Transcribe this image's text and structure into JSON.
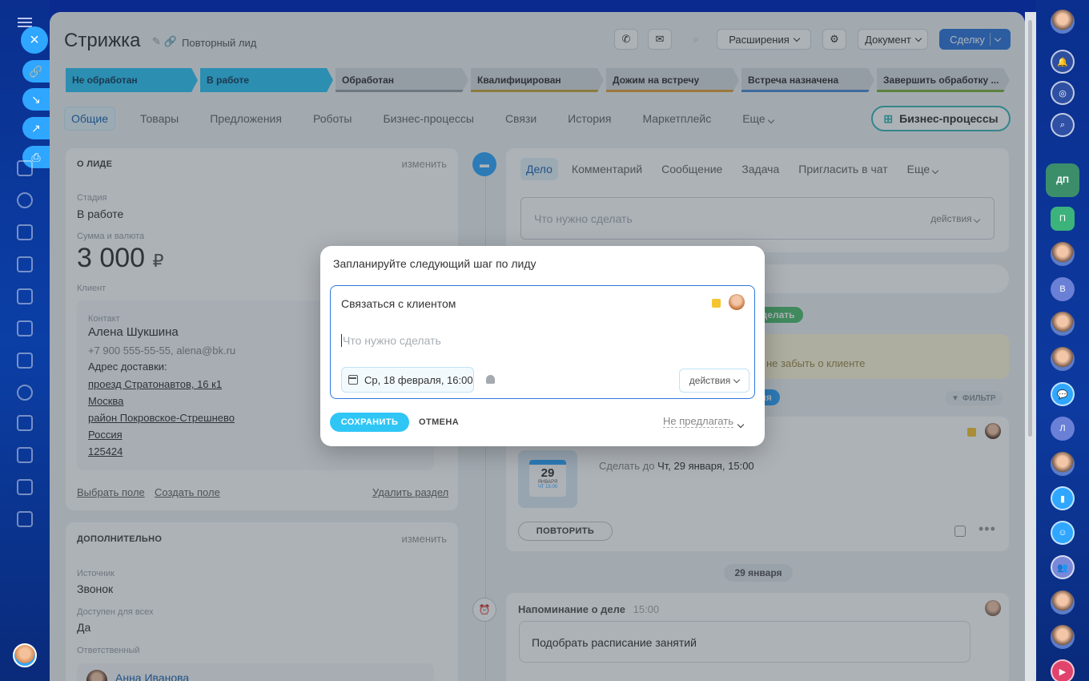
{
  "header": {
    "title": "Стрижка",
    "subtitle": "Повторный лид",
    "extensions_label": "Расширения",
    "document_label": "Документ",
    "primary_label": "Сделку"
  },
  "stages": [
    "Не обработан",
    "В работе",
    "Обработан",
    "Квалифицирован",
    "Дожим на встречу",
    "Встреча назначена",
    "Завершить обработку ..."
  ],
  "tabs": [
    "Общие",
    "Товары",
    "Предложения",
    "Роботы",
    "Бизнес-процессы",
    "Связи",
    "История",
    "Маркетплейс",
    "Еще"
  ],
  "bp_button": "Бизнес-процессы",
  "about": {
    "heading": "О ЛИДЕ",
    "edit": "изменить",
    "stage_label": "Стадия",
    "stage_value": "В работе",
    "sum_label": "Сумма и валюта",
    "sum_value": "3 000",
    "currency": "₽",
    "client_label": "Клиент",
    "contact_label": "Контакт",
    "contact_name": "Алена Шукшина",
    "contact_info": "+7 900 555-55-55, alena@bk.ru",
    "address_label": "Адрес доставки:",
    "address_lines": [
      "проезд Стратонавтов, 16 к1",
      "Москва",
      "район Покровское-Стрешнево",
      "Россия",
      "125424"
    ],
    "choose_field": "Выбрать поле",
    "create_field": "Создать поле",
    "delete_section": "Удалить раздел"
  },
  "extra": {
    "heading": "ДОПОЛНИТЕЛЬНО",
    "edit": "изменить",
    "source_label": "Источник",
    "source_value": "Звонок",
    "available_label": "Доступен для всех",
    "available_value": "Да",
    "responsible_label": "Ответственный",
    "responsible_name": "Анна Иванова"
  },
  "activity": {
    "tabs": [
      "Дело",
      "Комментарий",
      "Сообщение",
      "Задача",
      "Пригласить в чат",
      "Еще"
    ],
    "input_placeholder": "Что нужно сделать",
    "actions_label": "действия",
    "do_pill": "сделать",
    "reminder_note": "не забыть о клиенте",
    "today_pill": "дня",
    "filter_label": "ФИЛЬТР",
    "deadline_prefix": "Сделать до",
    "deadline_value": "Чт, 29 января, 15:00",
    "cal_day": "29",
    "cal_month": "ЯНВАРЯ",
    "cal_time": "ЧТ 15:00",
    "repeat_label": "ПОВТОРИТЬ",
    "date_chip": "29 января",
    "reminder_title": "Напоминание о деле",
    "reminder_time": "15:00",
    "reminder_text": "Подобрать расписание занятий"
  },
  "modal": {
    "title": "Запланируйте следующий шаг по лиду",
    "task_title": "Связаться с клиентом",
    "placeholder": "Что нужно сделать",
    "date": "Ср, 18 февраля, 16:00",
    "actions_label": "действия",
    "save_label": "СОХРАНИТЬ",
    "cancel_label": "ОТМЕНА",
    "no_suggest_label": "Не предлагать"
  },
  "rightrail": {
    "dp": "ДП",
    "p": "П",
    "v": "В",
    "l": "Л"
  },
  "colors": {
    "accent": "#2fc6f6",
    "primary": "#2f77dc",
    "bg_dark": "#0b2a8f"
  }
}
